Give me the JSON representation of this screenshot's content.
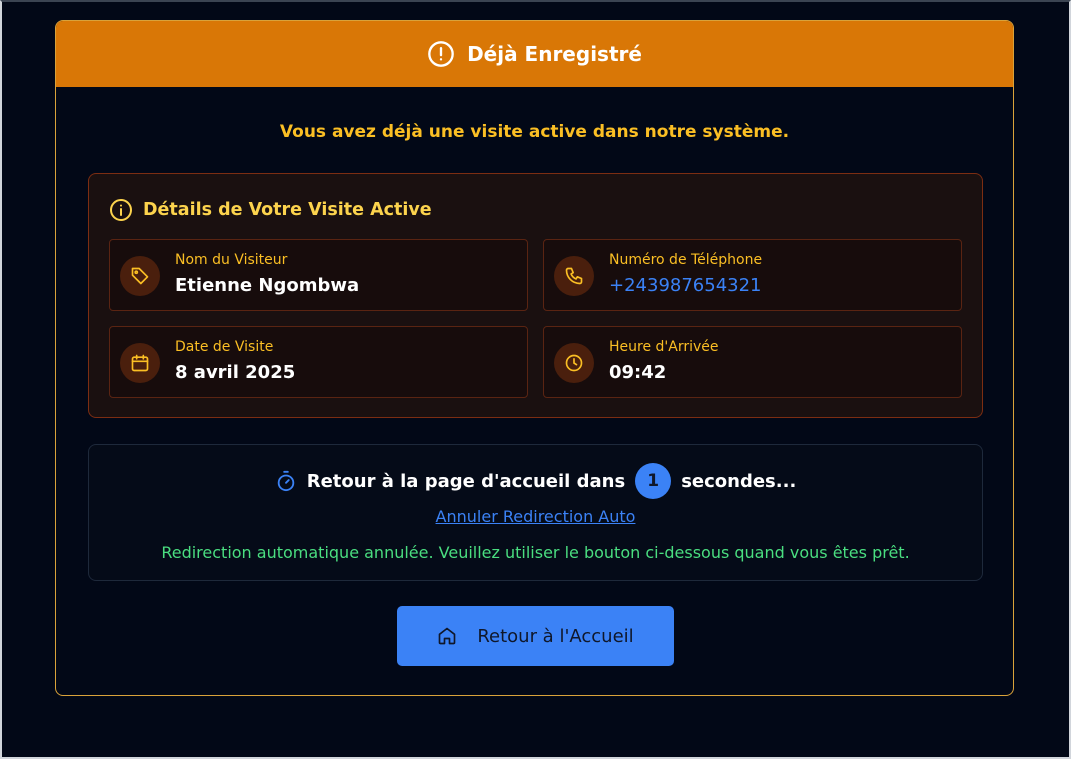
{
  "header": {
    "title": "Déjà Enregistré",
    "icon": "alert-circle-icon"
  },
  "subtitle": "Vous avez déjà une visite active dans notre système.",
  "details": {
    "title": "Détails de Votre Visite Active",
    "items": [
      {
        "label": "Nom du Visiteur",
        "value": "Etienne Ngombwa",
        "icon": "tag-icon"
      },
      {
        "label": "Numéro de Téléphone",
        "value": "+243987654321",
        "icon": "phone-icon"
      },
      {
        "label": "Date de Visite",
        "value": "8 avril 2025",
        "icon": "calendar-icon"
      },
      {
        "label": "Heure d'Arrivée",
        "value": "09:42",
        "icon": "clock-icon"
      }
    ]
  },
  "redirect": {
    "prefix": "Retour à la page d'accueil dans",
    "countdown": "1",
    "suffix": "secondes...",
    "cancel_label": "Annuler Redirection Auto",
    "notice": "Redirection automatique annulée. Veuillez utiliser le bouton ci-dessous quand vous êtes prêt."
  },
  "home_button": {
    "label": "Retour à l'Accueil",
    "icon": "home-icon"
  },
  "colors": {
    "header": "#d97706",
    "accent_amber": "#fbbf24",
    "link_blue": "#3b82f6",
    "notice_green": "#4ade80",
    "background": "#020817"
  }
}
